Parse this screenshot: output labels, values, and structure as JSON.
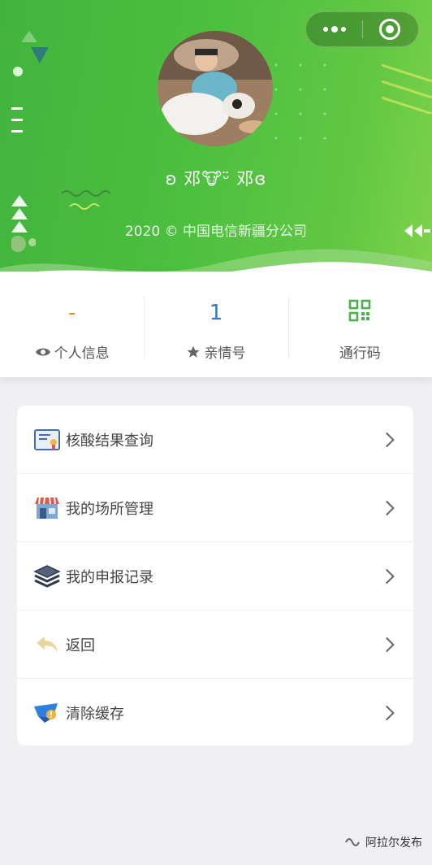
{
  "header": {
    "nickname": "ʚ 邓🐮ᵕ̈ 邓ɞ",
    "copyright": "2020 © 中国电信新疆分公司"
  },
  "stats": [
    {
      "value": "-",
      "label": "个人信息",
      "icon": "eye-icon",
      "value_color": "#f08a24"
    },
    {
      "value": "1",
      "label": "亲情号",
      "icon": "star-icon",
      "value_color": "#2b7bd6"
    },
    {
      "value": "",
      "label": "通行码",
      "icon": "qr-code-icon",
      "value_color": "#4caf50"
    }
  ],
  "menu": [
    {
      "label": "核酸结果查询",
      "icon": "certificate-icon"
    },
    {
      "label": "我的场所管理",
      "icon": "storefront-icon"
    },
    {
      "label": "我的申报记录",
      "icon": "layers-icon"
    },
    {
      "label": "返回",
      "icon": "return-arrow-icon"
    },
    {
      "label": "清除缓存",
      "icon": "clear-cache-icon"
    }
  ],
  "watermark": "阿拉尔发布",
  "colors": {
    "header_green": "#4cbf3f",
    "accent_orange": "#f08a24",
    "accent_blue": "#2b7bd6",
    "background": "#efeff4"
  }
}
